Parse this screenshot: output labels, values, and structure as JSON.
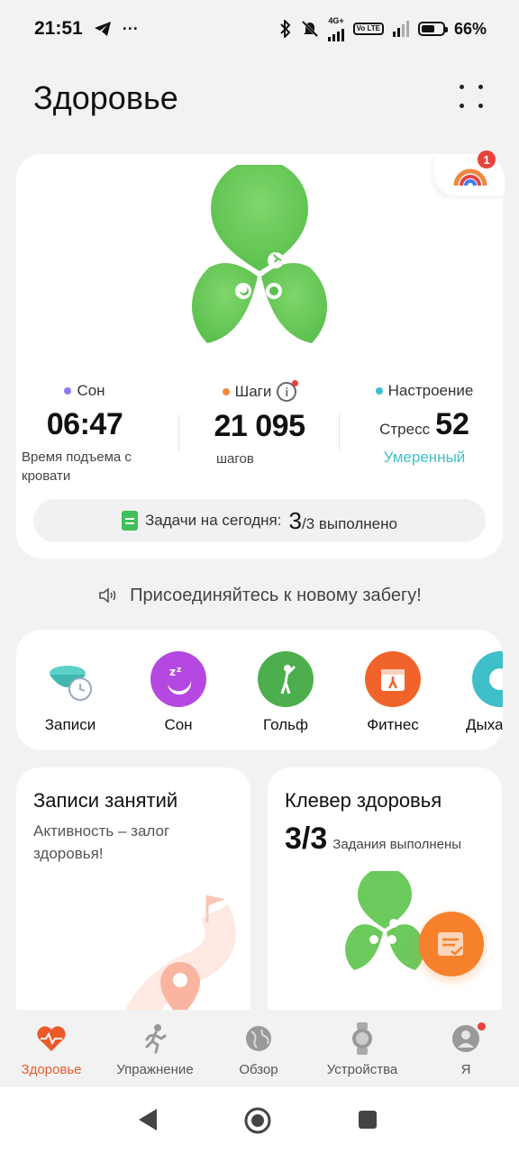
{
  "status_bar": {
    "time": "21:51",
    "dots": "···",
    "network": "4G+",
    "volte": "Vo LTE",
    "battery": "66%"
  },
  "header": {
    "title": "Здоровье"
  },
  "main_card": {
    "badge_count": "1",
    "metrics": {
      "sleep": {
        "label": "Сон",
        "value": "06:47",
        "sub": "Время подъема с кровати",
        "color": "#8b7cf0"
      },
      "steps": {
        "label": "Шаги",
        "value": "21 095",
        "sub": "шагов",
        "color": "#f0883e"
      },
      "mood": {
        "label": "Настроение",
        "prefix": "Стресс",
        "value": "52",
        "sub": "Умеренный",
        "color": "#3fbfd0"
      }
    },
    "tasks": {
      "prefix": "Задачи на сегодня:",
      "done": "3",
      "suffix": "/3 выполнено"
    }
  },
  "announcement": "Присоединяйтесь к новому забегу!",
  "shortcuts": [
    {
      "label": "Записи",
      "icon": "bowl-clock-icon"
    },
    {
      "label": "Сон",
      "icon": "moon-sleep-icon"
    },
    {
      "label": "Гольф",
      "icon": "golf-icon"
    },
    {
      "label": "Фитнес",
      "icon": "fitness-calendar-icon"
    },
    {
      "label": "Дыха",
      "icon": "breath-icon"
    }
  ],
  "cards": {
    "records": {
      "title": "Записи занятий",
      "desc": "Активность – залог здоровья!"
    },
    "clover": {
      "title": "Клевер здоровья",
      "count": "3/3",
      "sub": "Задания выполнены"
    }
  },
  "bottom_nav": [
    {
      "label": "Здоровье",
      "icon": "heart-pulse-icon",
      "active": true
    },
    {
      "label": "Упражнение",
      "icon": "runner-icon",
      "active": false
    },
    {
      "label": "Обзор",
      "icon": "globe-icon",
      "active": false
    },
    {
      "label": "Устройства",
      "icon": "watch-icon",
      "active": false
    },
    {
      "label": "Я",
      "icon": "profile-icon",
      "active": false
    }
  ],
  "colors": {
    "accent": "#ec5a2a",
    "clover_green": "#6cc95c",
    "mood_link": "#3fbfc8"
  }
}
